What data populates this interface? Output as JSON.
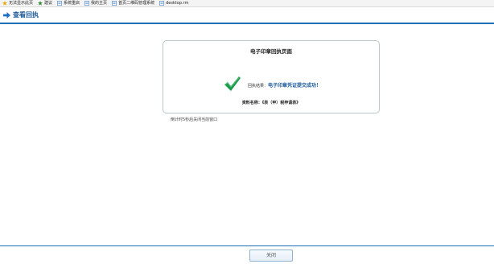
{
  "bookmarks": [
    {
      "label": "无法显示此页",
      "icon": "star-icon",
      "color": "#e8a400"
    },
    {
      "label": "建议",
      "icon": "star-icon",
      "color": "#2b8a2b"
    },
    {
      "label": "系统重启",
      "icon": "page-icon",
      "color": "#3a78c2"
    },
    {
      "label": "我的主页",
      "icon": "page-icon",
      "color": "#3a78c2"
    },
    {
      "label": "首页二维码管理系统",
      "icon": "page-icon",
      "color": "#3a78c2"
    },
    {
      "label": "desktop.rm",
      "icon": "page-icon",
      "color": "#3a78c2"
    }
  ],
  "header": {
    "title": "查看回执"
  },
  "panel": {
    "title": "电子印章回执页面",
    "result_label": "回执结果：",
    "result_value": "电子印章凭证提交成功！",
    "doc_line": "资料名称：《表（甲）税申请表》"
  },
  "countdown": "倒计时5秒后关闭当前窗口",
  "close_label": "关闭",
  "colors": {
    "accent": "#1e6fb8",
    "success": "#1a9a4a"
  }
}
